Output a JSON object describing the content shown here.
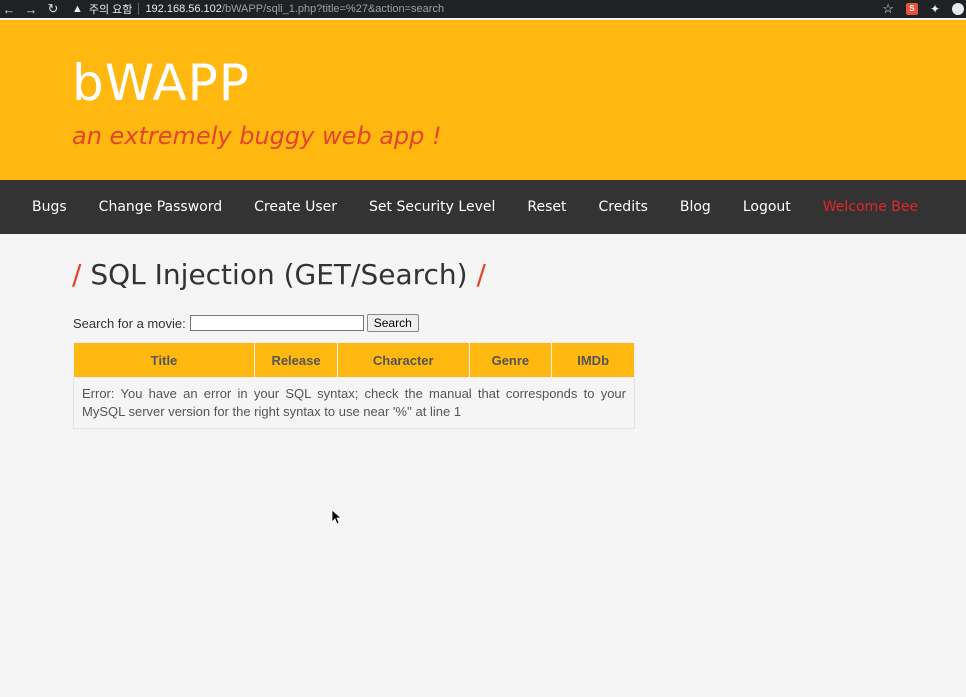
{
  "browser": {
    "back_glyph": "←",
    "forward_glyph": "→",
    "reload_glyph": "↻",
    "warning_glyph": "▲",
    "warning_text": "주의 요함",
    "url_host": "192.168.56.102",
    "url_path": "/bWAPP/sqli_1.php?title=%27&action=search",
    "star_glyph": "☆",
    "puzzle_glyph": "✦"
  },
  "header": {
    "logo": "bWAPP",
    "tagline": "an extremely buggy web app !",
    "bg_color": "#ffb80f",
    "tagline_color": "#e2452c"
  },
  "menu": {
    "items": [
      "Bugs",
      "Change Password",
      "Create User",
      "Set Security Level",
      "Reset",
      "Credits",
      "Blog",
      "Logout"
    ],
    "welcome": "Welcome Bee"
  },
  "page": {
    "slash": "/",
    "title": "SQL Injection (GET/Search)"
  },
  "search": {
    "label": "Search for a movie:",
    "value": "",
    "button": "Search"
  },
  "table": {
    "headers": [
      "Title",
      "Release",
      "Character",
      "Genre",
      "IMDb"
    ],
    "error": "Error: You have an error in your SQL syntax; check the manual that corresponds to your MySQL server version for the right syntax to use near '%'' at line 1"
  }
}
